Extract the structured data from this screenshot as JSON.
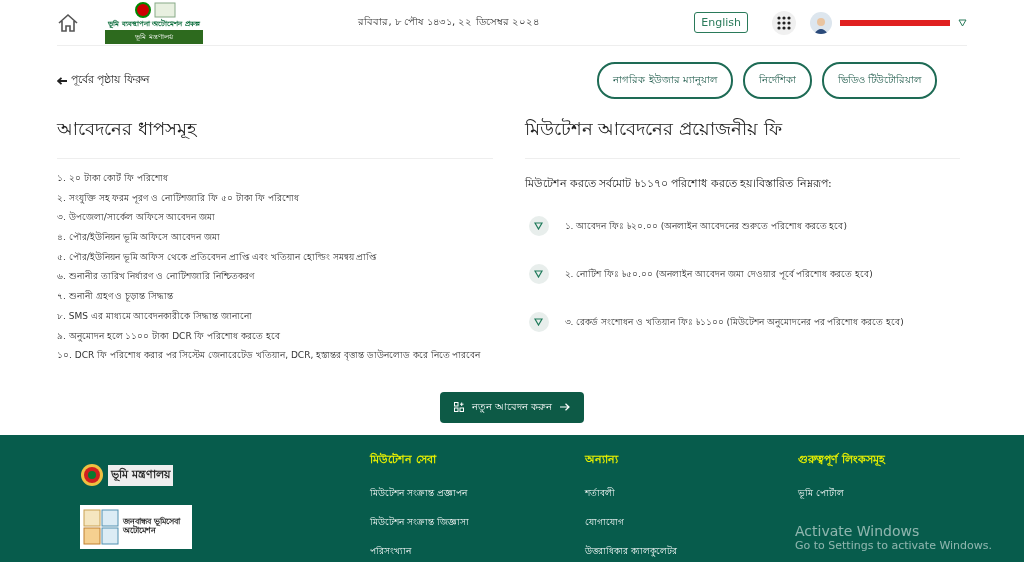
{
  "header": {
    "logo_title": "ভূমি ব্যবস্থাপনা অটোমেশন প্রকল্প",
    "logo_ministry": "ভূমি মন্ত্রণালয়",
    "date": "রবিবার, ৮ পৌষ ১৪৩১, ২২ ডিসেম্বর ২০২৪",
    "language_button": "English"
  },
  "back_link": "পূর্বের পৃষ্ঠায় ফিরুন",
  "help_buttons": [
    "নাগরিক ইউজার ম্যানুয়াল",
    "নির্দেশিকা",
    "ভিডিও টিউটোরিয়াল"
  ],
  "steps": {
    "title": "আবেদনের ধাপসমূহ",
    "items": [
      "১. ২০ টাকা কোর্ট ফি পরিশোধ",
      "২. সংযুক্তি সহ ফরম পূরণ ও নোটিশজারি ফি ৫০ টাকা ফি পরিশোধ",
      "৩. উপজেলা/সার্কেল অফিসে আবেদন জমা",
      "৪. পৌর/ইউনিয়ন ভূমি অফিসে আবেদন জমা",
      "৫. পৌর/ইউনিয়ন ভূমি অফিস থেকে প্রতিবেদন প্রাপ্তি এবং খতিয়ান হোল্ডিং সমন্বয় প্রাপ্তি",
      "৬. শুনানীর তারিখ নির্ধারণ ও নোটিশজারি নিশ্চিতকরণ",
      "৭. শুনানী গ্রহণ ও চূড়ান্ত সিদ্ধান্ত",
      "৮. SMS এর মাধ্যমে আবেদনকারীকে সিদ্ধান্ত জানানো",
      "৯. অনুমোদন হলে ১১০০ টাকা DCR ফি পরিশোধ করতে হবে",
      "১০. DCR ফি পরিশোধ করার পর সিস্টেম জেনারেটেড খতিয়ান, DCR, হস্তান্তর বৃত্তান্ত ডাউনলোড করে নিতে পারবেন"
    ]
  },
  "fees": {
    "title": "মিউটেশন আবেদনের প্রয়োজনীয় ফি",
    "summary": "মিউটেশন করতে সর্বমোট ৳১১৭০ পরিশোধ করতে হয়।বিস্তারিত নিম্নরূপ:",
    "items": [
      "১. আবেদন ফিঃ ৳২০.০০ (অনলাইন আবেদনের শুরুতে পরিশোধ করতে হবে)",
      "২. নোটিশ ফিঃ ৳৫০.০০ (অনলাইন আবেদন জমা দেওয়ার পূর্বে পরিশোধ করতে হবে)",
      "৩. রেকর্ড সংশোধন ও খতিয়ান ফিঃ ৳১১০০ (মিউটেশন অনুমোদনের পর পরিশোধ করতে হবে)"
    ]
  },
  "new_application_button": "নতুন আবেদন করুন",
  "footer": {
    "ministry_logo": "ভূমি মন্ত্রণালয়",
    "automation_logo": "জনবান্ধব ভূমিসেবা অটোমেশন",
    "columns": [
      {
        "title": "মিউটেশন সেবা",
        "links": [
          "মিউটেশন সংক্রান্ত প্রজ্ঞাপন",
          "মিউটেশন সংক্রান্ত জিজ্ঞাসা",
          "পরিসংখ্যান"
        ]
      },
      {
        "title": "অন্যান্য",
        "links": [
          "শর্তাবলী",
          "যোগাযোগ",
          "উত্তরাধিকার ক্যালকুলেটর"
        ]
      },
      {
        "title": "গুরুত্বপূর্ণ লিংকসমূহ",
        "links": [
          "ভূমি পোর্টাল"
        ]
      }
    ]
  },
  "os_notice": {
    "title": "Activate Windows",
    "subtitle": "Go to Settings to activate Windows."
  }
}
